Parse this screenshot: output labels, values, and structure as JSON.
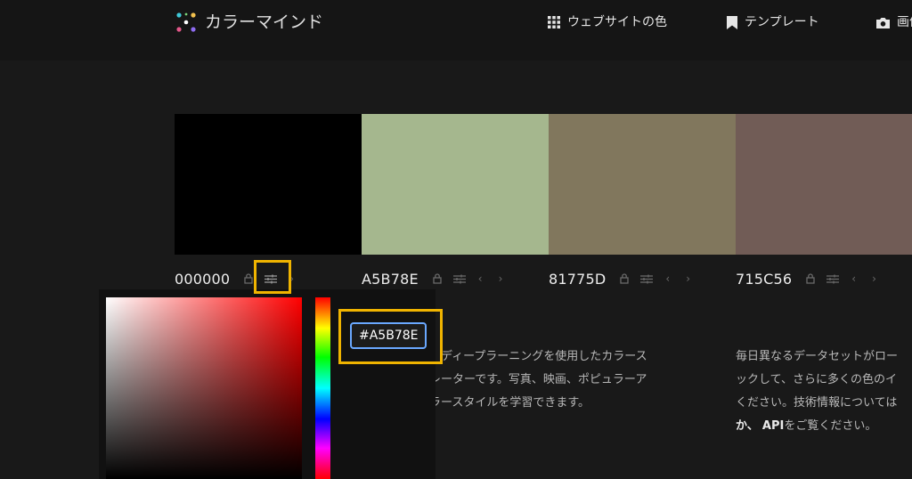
{
  "header": {
    "brand": "カラーマインド",
    "nav": [
      {
        "label": "ウェブサイトの色",
        "icon": "grid-icon"
      },
      {
        "label": "テンプレート",
        "icon": "bookmark-icon"
      },
      {
        "label": "画像",
        "icon": "camera-icon"
      }
    ]
  },
  "palette": [
    {
      "hex": "000000",
      "color": "#000000"
    },
    {
      "hex": "A5B78E",
      "color": "#A5B78E"
    },
    {
      "hex": "81775D",
      "color": "#81775D"
    },
    {
      "hex": "715C56",
      "color": "#715C56"
    }
  ],
  "picker": {
    "hex_value": "#A5B78E"
  },
  "description": {
    "left_lines": [
      "、ディープラーニングを使用したカラース",
      "レーターです。写真、映画、ポピュラーア",
      "ラースタイルを学習できます。"
    ],
    "right_lines": [
      "毎日異なるデータセットがロー",
      "ックして、さらに多くの色のイ",
      "ください。技術情報については"
    ],
    "right_last_prefix": "か、",
    "right_last_bold": "API",
    "right_last_suffix": "をご覧ください。"
  },
  "highlight_color": "#f0b400"
}
